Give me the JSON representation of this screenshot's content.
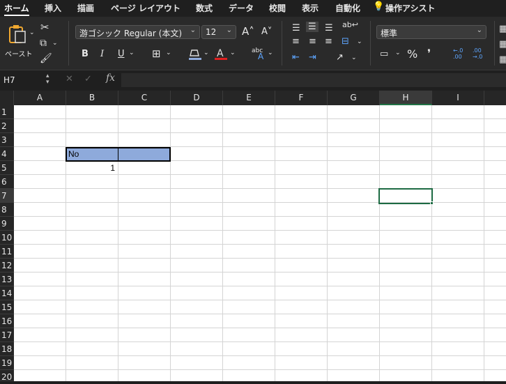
{
  "tabs": [
    "ホーム",
    "挿入",
    "描画",
    "ページ レイアウト",
    "数式",
    "データ",
    "校閲",
    "表示",
    "自動化",
    "操作アシスト"
  ],
  "ribbon": {
    "paste_label": "ペースト",
    "font_name": "游ゴシック Regular (本文)",
    "font_size": "12",
    "bold": "B",
    "italic": "I",
    "underline": "U",
    "number_format": "標準",
    "percent": "%",
    "comma": "❜",
    "inc_decimal": "←.0 .00",
    "dec_decimal": ".00 →.0"
  },
  "formula_bar": {
    "name_box": "H7",
    "fx": "fx",
    "value": ""
  },
  "sheet": {
    "columns": [
      "A",
      "B",
      "C",
      "D",
      "E",
      "F",
      "G",
      "H",
      "I"
    ],
    "rows": [
      "1",
      "2",
      "3",
      "4",
      "5",
      "6",
      "7",
      "8",
      "9",
      "10",
      "11",
      "12",
      "13",
      "14",
      "15",
      "16",
      "17",
      "18",
      "19",
      "20"
    ],
    "selected_cell": "H7",
    "cells": {
      "B4": "No",
      "B5": "1"
    },
    "header_fill": "#8eaadb"
  }
}
